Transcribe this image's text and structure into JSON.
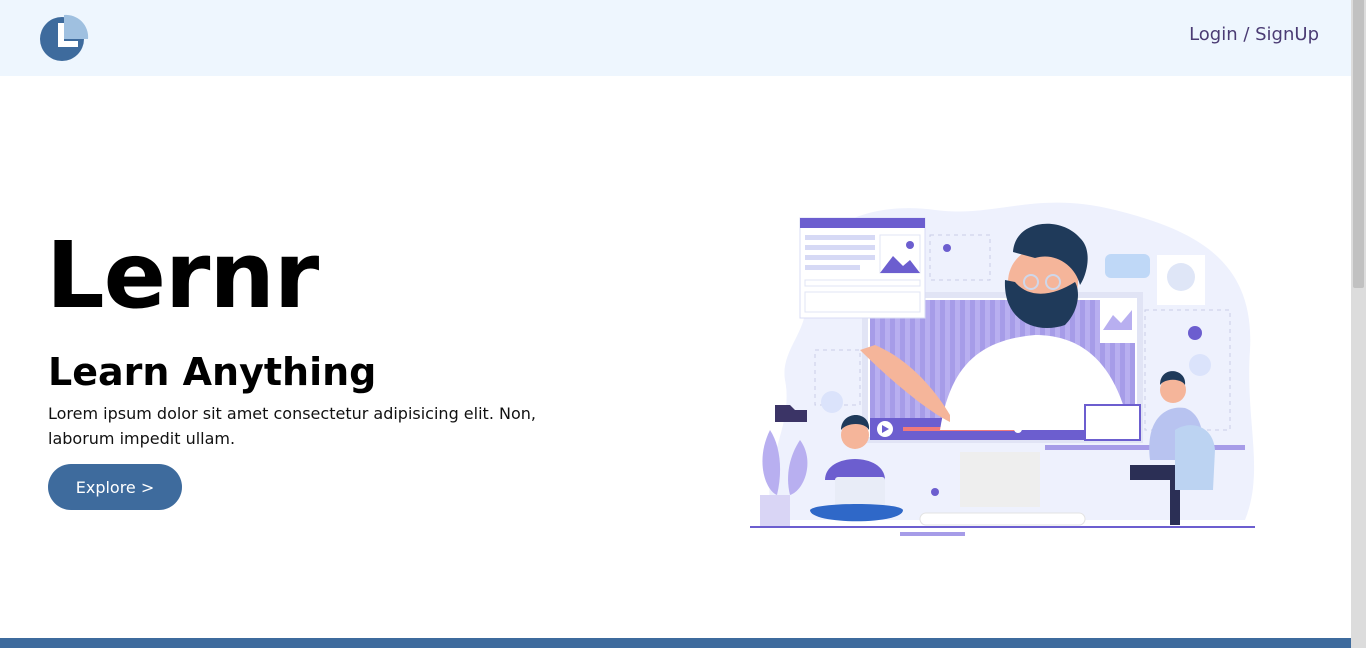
{
  "header": {
    "logo_name": "lernr-logo",
    "auth_link": "Login / SignUp"
  },
  "hero": {
    "title": "Lernr",
    "subtitle": "Learn Anything",
    "description": "Lorem ipsum dolor sit amet consectetur adipisicing elit. Non, laborum impedit ullam.",
    "button_label": "Explore >"
  },
  "colors": {
    "navbar_bg": "#eef6fe",
    "accent": "#3e6b9d",
    "nav_text": "#4b3c74",
    "illustration_purple": "#6c5ecf"
  }
}
